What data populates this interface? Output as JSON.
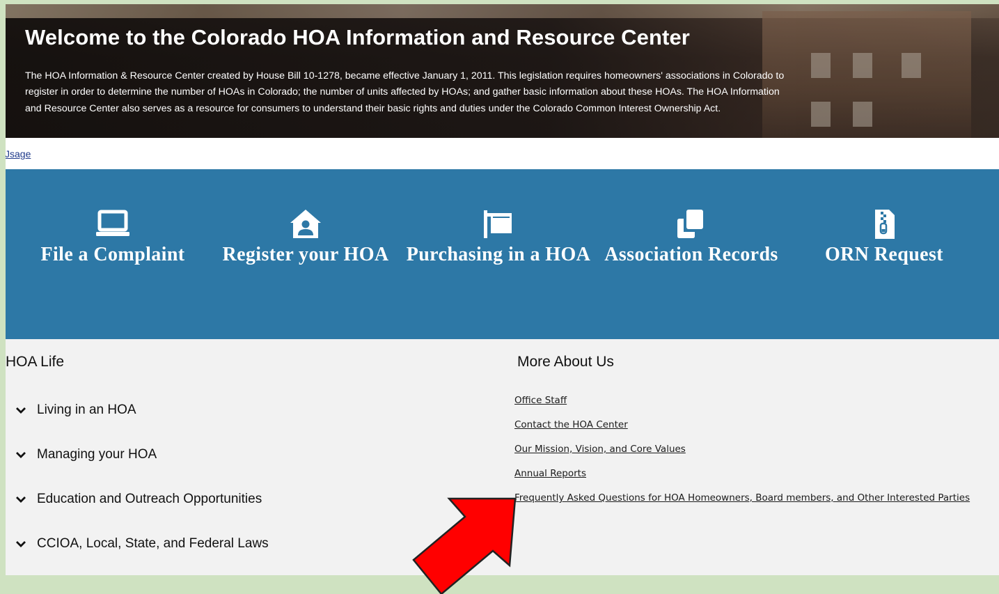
{
  "hero": {
    "title": "Welcome to the Colorado HOA Information and Resource Center",
    "description": "The HOA Information & Resource Center created by House Bill 10-1278, became effective January 1, 2011. This legislation requires homeowners' associations in Colorado to register in order to determine the number of HOAs in Colorado; the number of units affected by HOAs; and gather basic information about these HOAs. The HOA Information and Resource Center also serves as a resource for consumers to understand their basic rights and duties under the Colorado Common Interest Ownership Act."
  },
  "usage_link": "Jsage",
  "banner": {
    "color": "#2d78a6",
    "tiles": [
      {
        "label": "File a Complaint",
        "icon": "laptop-icon"
      },
      {
        "label": "Register your HOA",
        "icon": "house-user-icon"
      },
      {
        "label": "Purchasing in a HOA",
        "icon": "sign-icon"
      },
      {
        "label": "Association Records",
        "icon": "copy-documents-icon"
      },
      {
        "label": "ORN Request",
        "icon": "zip-file-icon"
      }
    ]
  },
  "hoa_life": {
    "title": "HOA Life",
    "items": [
      "Living in an HOA",
      "Managing your HOA",
      "Education and Outreach Opportunities",
      "CCIOA, Local, State, and Federal Laws"
    ]
  },
  "more_about": {
    "title": "More About Us",
    "links": [
      "Office Staff",
      "Contact the HOA Center",
      "Our Mission, Vision, and Core Values",
      "Annual Reports",
      "Frequently Asked Questions for HOA Homeowners, Board members, and Other Interested Parties"
    ]
  },
  "annotation": {
    "arrow_color": "#ff0000"
  }
}
